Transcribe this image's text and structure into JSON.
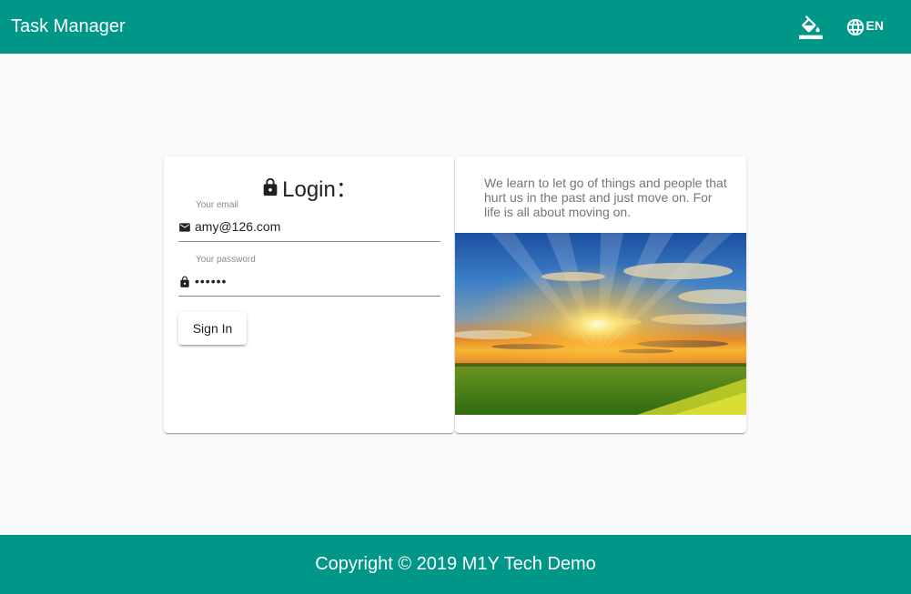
{
  "header": {
    "title": "Task Manager",
    "theme_icon": "format-color-fill-icon",
    "language_icon": "globe-icon",
    "language_label": "EN"
  },
  "login": {
    "heading": "Login：",
    "heading_icon": "lock-icon",
    "email": {
      "label": "Your email",
      "value": "amy@126.com",
      "icon": "email-icon"
    },
    "password": {
      "label": "Your password",
      "value": "123456",
      "icon": "lock-icon"
    },
    "sign_in_label": "Sign In"
  },
  "quote": {
    "text": "We learn to let go of things and people that hurt us in the past and just move on. For life is all about moving on."
  },
  "footer": {
    "copyright": "Copyright © 2019 M1Y Tech Demo"
  },
  "colors": {
    "primary": "#009688",
    "background": "#fafafa"
  }
}
